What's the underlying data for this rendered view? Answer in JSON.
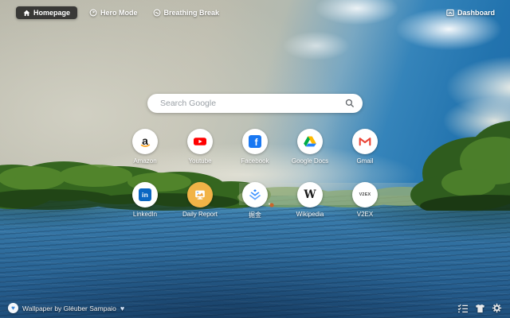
{
  "topbar": {
    "homepage_label": "Homepage",
    "hero_mode_label": "Hero Mode",
    "breathing_break_label": "Breathing Break",
    "dashboard_label": "Dashboard"
  },
  "search": {
    "placeholder": "Search Google"
  },
  "shortcuts": {
    "row1": [
      {
        "label": "Amazon",
        "icon": "amazon-icon",
        "icon_text": "a"
      },
      {
        "label": "Youtube",
        "icon": "youtube-icon"
      },
      {
        "label": "Facebook",
        "icon": "facebook-icon",
        "icon_text": "f"
      },
      {
        "label": "Google Docs",
        "icon": "google-drive-icon"
      },
      {
        "label": "Gmail",
        "icon": "gmail-icon"
      }
    ],
    "row2": [
      {
        "label": "LinkedIn",
        "icon": "linkedin-icon",
        "icon_text": "in"
      },
      {
        "label": "Daily Report",
        "icon": "daily-report-icon"
      },
      {
        "label": "掘金",
        "icon": "juejin-icon"
      },
      {
        "label": "Wikipedia",
        "icon": "wikipedia-icon",
        "icon_text": "W"
      },
      {
        "label": "V2EX",
        "icon": "v2ex-icon",
        "icon_text": "V2EX"
      }
    ]
  },
  "footer": {
    "credit_text": "Wallpaper by Gléuber Sampaio",
    "credit_heart": "♥",
    "badge_heart": "♥"
  },
  "colors": {
    "youtube_red": "#ff0000",
    "facebook_blue": "#1877f2",
    "linkedin_blue": "#0a66c2",
    "juejin_blue": "#1e80ff",
    "gmail_red": "#ea4335",
    "amazon_orange": "#ff9900",
    "daily_report_amber": "#f1b347",
    "drive_green": "#00ac47",
    "drive_yellow": "#ffba00",
    "drive_blue": "#2684fc",
    "sky_blue": "#2a7ab8",
    "water_blue": "#2f6d9d"
  }
}
